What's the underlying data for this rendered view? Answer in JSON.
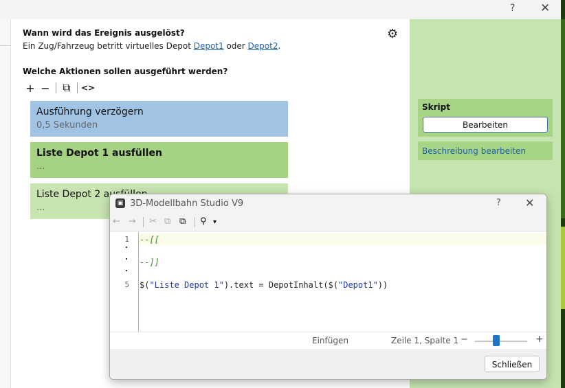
{
  "window": {
    "help_icon": "?",
    "close_icon": "✕"
  },
  "trigger": {
    "question": "Wann wird das Ereignis ausgelöst?",
    "text_prefix": "Ein Zug/Fahrzeug betritt virtuelles Depot ",
    "link1": "Depot1",
    "text_middle": " oder ",
    "link2": "Depot2",
    "text_suffix": "."
  },
  "actions_section": {
    "question": "Welche Aktionen sollen ausgeführt werden?",
    "toolbar": [
      "add-icon",
      "remove-icon",
      "copy-icon",
      "code-icon"
    ],
    "items": [
      {
        "title": "Ausführung verzögern",
        "subtitle": "0,5 Sekunden",
        "color": "#a2c4e4"
      },
      {
        "title": "Liste Depot 1 ausfüllen",
        "subtitle": "...",
        "color": "#a6d283"
      },
      {
        "title": "Liste Depot 2 ausfüllen",
        "subtitle": "...",
        "color": "#c8e4b1"
      }
    ]
  },
  "right_panel": {
    "script_label": "Skript",
    "edit_button": "Bearbeiten",
    "description_link": "Beschreibung bearbeiten"
  },
  "dialog": {
    "title": "3D-Modellbahn Studio V9",
    "help_icon": "?",
    "close_icon": "✕",
    "toolbar": [
      "back-icon",
      "forward-icon",
      "cut-icon",
      "copy-icon",
      "paste-icon",
      "search-icon",
      "chevron-down-icon"
    ],
    "line_numbers": {
      "first": "1",
      "fifth": "5"
    },
    "code": {
      "line1": "--[[",
      "line3": "--]]",
      "line5_a": "$(",
      "line5_b": "\"Liste Depot 1\"",
      "line5_c": ").text = DepotInhalt($(",
      "line5_d": "\"Depot1\"",
      "line5_e": "))"
    },
    "status": {
      "mode": "Einfügen",
      "position": "Zeile 1, Spalte 1",
      "zoom_minus": "−",
      "zoom_plus": "+"
    },
    "close_button": "Schließen"
  },
  "colors": {
    "accent_blue": "#1d74c9",
    "link": "#1f5fa8",
    "panel_green": "#c6e4b0"
  }
}
